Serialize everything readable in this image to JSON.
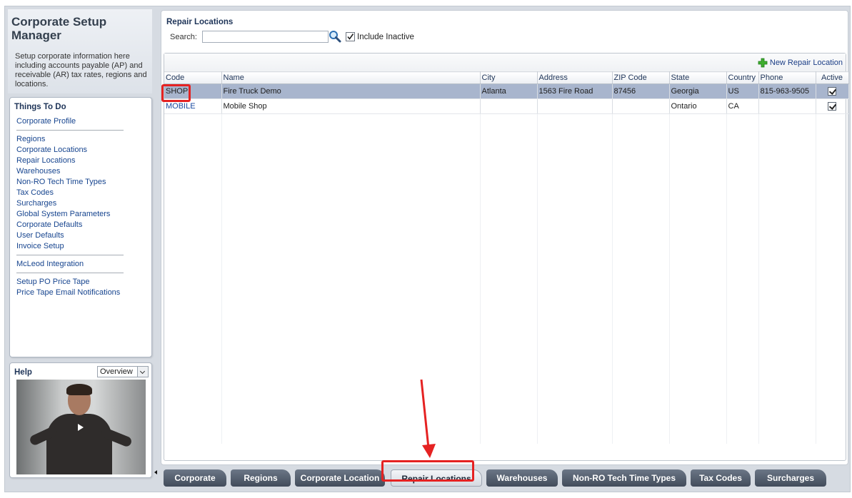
{
  "left_panel": {
    "title": "Corporate Setup Manager",
    "description": "Setup corporate information here including accounts payable (AP) and receivable (AR) tax rates, regions and locations.",
    "things_to_do": {
      "title": "Things To Do",
      "groups": [
        [
          "Corporate Profile"
        ],
        [
          "Regions",
          "Corporate Locations",
          "Repair Locations",
          "Warehouses",
          "Non-RO Tech Time Types",
          "Tax Codes",
          "Surcharges",
          "Global System Parameters",
          "Corporate Defaults",
          "User Defaults",
          "Invoice Setup"
        ],
        [
          "McLeod Integration"
        ],
        [
          "Setup PO Price Tape",
          "Price Tape Email Notifications"
        ]
      ]
    },
    "help": {
      "title": "Help",
      "select_value": "Overview"
    }
  },
  "main": {
    "title": "Repair Locations",
    "search": {
      "label": "Search:",
      "value": "",
      "placeholder": ""
    },
    "include_inactive": {
      "label": "Include Inactive",
      "checked": true
    },
    "new_button": "New Repair Location",
    "table": {
      "columns": [
        "Code",
        "Name",
        "City",
        "Address",
        "ZIP Code",
        "State",
        "Country",
        "Phone",
        "Active"
      ],
      "rows": [
        {
          "code": "SHOP",
          "name": "Fire Truck Demo",
          "city": "Atlanta",
          "address": "1563 Fire Road",
          "zip": "87456",
          "state": "Georgia",
          "country": "US",
          "phone": "815-963-9505",
          "active": true,
          "selected": true
        },
        {
          "code": "MOBILE",
          "name": "Mobile Shop",
          "city": "",
          "address": "",
          "zip": "",
          "state": "Ontario",
          "country": "CA",
          "phone": "",
          "active": true,
          "selected": false
        }
      ]
    }
  },
  "tabs": {
    "items": [
      "Corporate",
      "Regions",
      "Corporate Location",
      "Repair Locations",
      "Warehouses",
      "Non-RO Tech Time Types",
      "Tax Codes",
      "Surcharges"
    ],
    "active": "Repair Locations"
  },
  "colors": {
    "selected_row": "#a8b5cd",
    "highlight": "#e52222",
    "tab_dark": "#424c5b",
    "link": "#17458f"
  }
}
